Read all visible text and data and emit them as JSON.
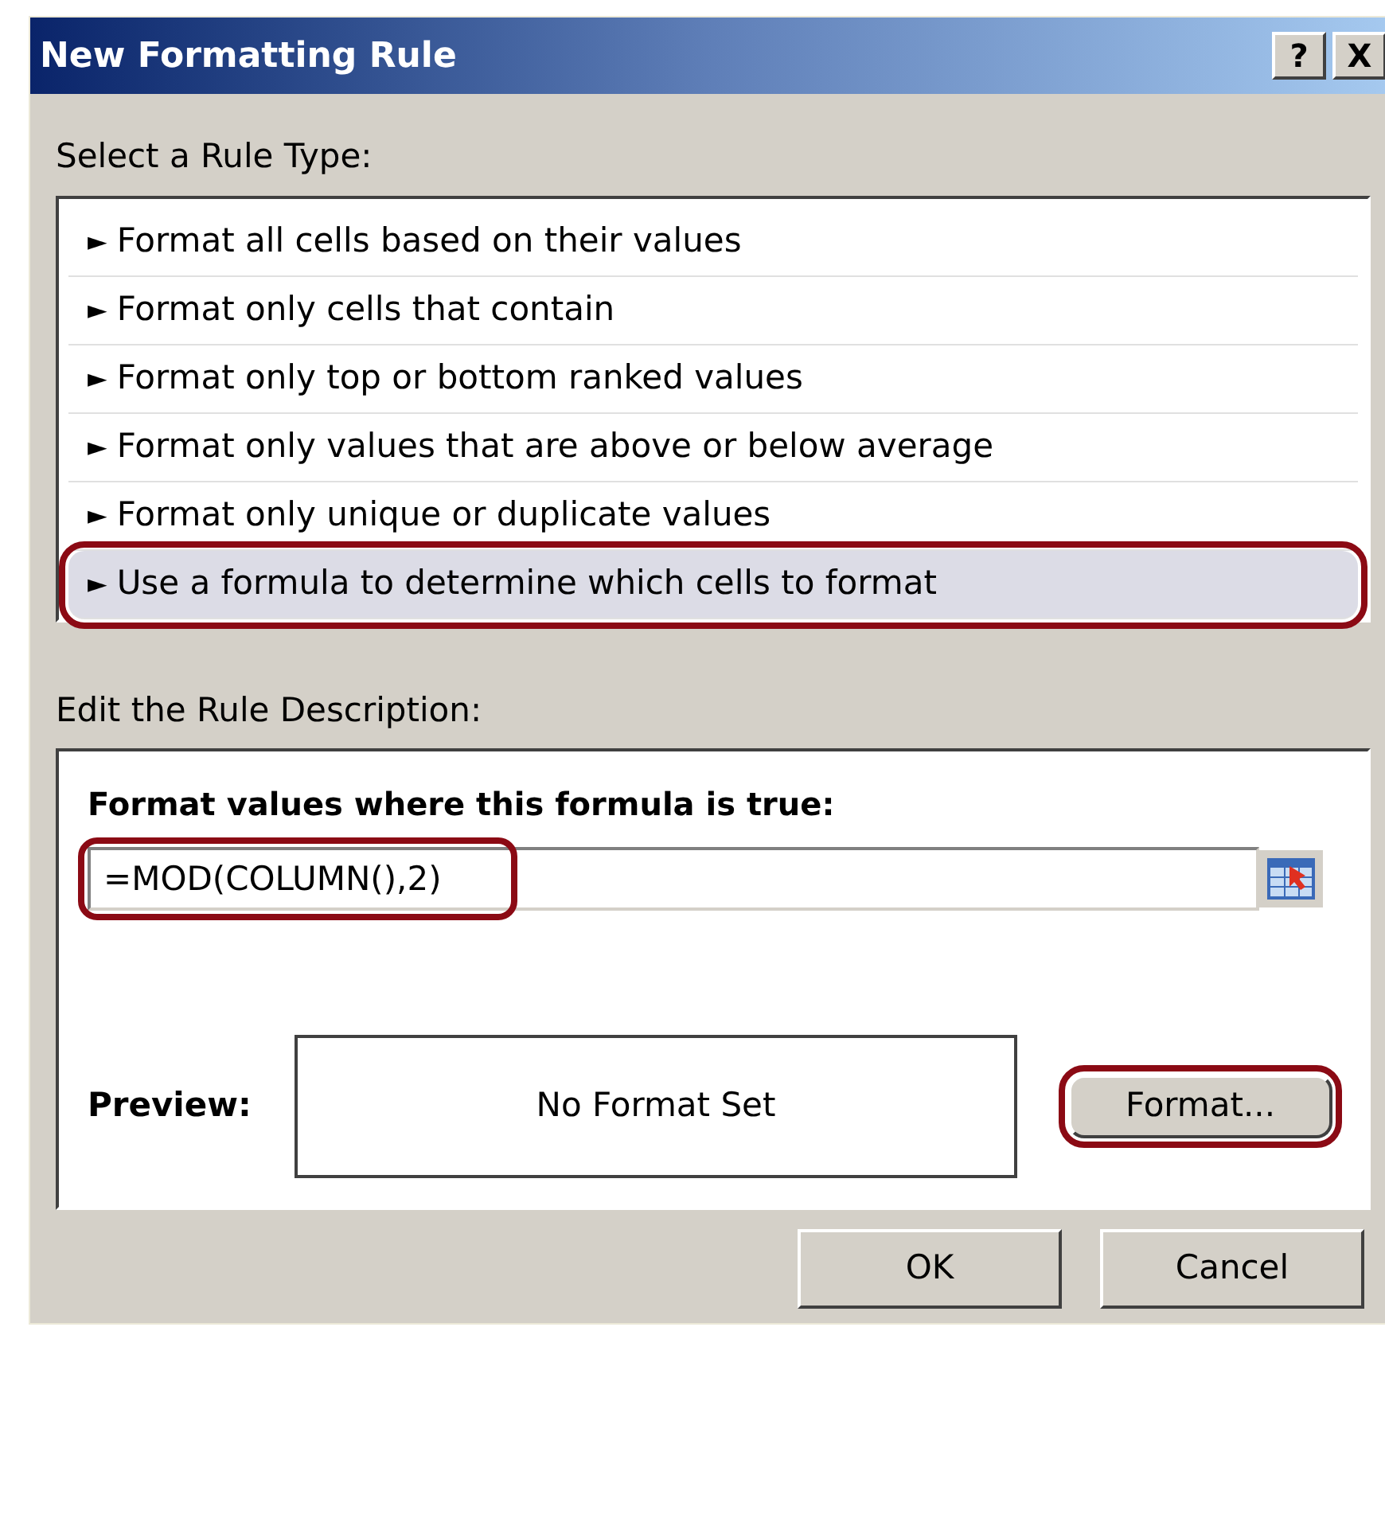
{
  "window": {
    "title": "New Formatting Rule",
    "help_button": "?",
    "close_button": "X"
  },
  "rule_type_label": "Select a Rule Type:",
  "rule_types": [
    {
      "marker": "►",
      "label": "Format all cells based on their values",
      "selected": false,
      "circled": false
    },
    {
      "marker": "►",
      "label": "Format only cells that contain",
      "selected": false,
      "circled": false
    },
    {
      "marker": "►",
      "label": "Format only top or bottom ranked values",
      "selected": false,
      "circled": false
    },
    {
      "marker": "►",
      "label": "Format only values that are above or below average",
      "selected": false,
      "circled": false
    },
    {
      "marker": "►",
      "label": "Format only unique or duplicate values",
      "selected": false,
      "circled": false
    },
    {
      "marker": "►",
      "label": "Use a formula to determine which cells to format",
      "selected": true,
      "circled": true
    }
  ],
  "description_label": "Edit the Rule Description:",
  "formula_label": "Format values where this formula is true:",
  "formula": {
    "value": "=MOD(COLUMN(),2)",
    "circled": true
  },
  "preview": {
    "label": "Preview:",
    "sample": "No Format Set"
  },
  "format_button": {
    "label": "Format...",
    "circled": true
  },
  "buttons": [
    "OK",
    "Cancel"
  ]
}
